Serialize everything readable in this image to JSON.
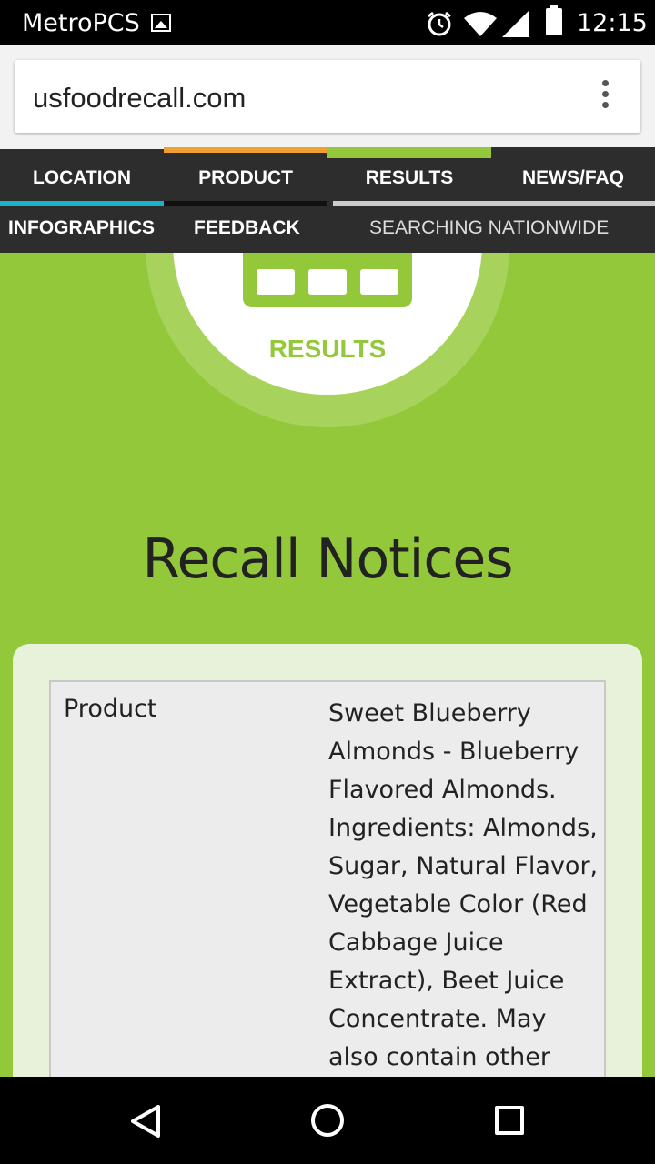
{
  "status_bar": {
    "carrier": "MetroPCS",
    "time": "12:15"
  },
  "browser": {
    "url": "usfoodrecall.com"
  },
  "nav": {
    "tabs": [
      {
        "label": "LOCATION",
        "top_color": "#2d2d2d",
        "bottom_color": "#1ab2c8"
      },
      {
        "label": "PRODUCT",
        "top_color": "#f0a030",
        "bottom_color": "#111111"
      },
      {
        "label": "RESULTS",
        "top_color": "#93c83b",
        "bottom_color": "#cccccc"
      },
      {
        "label": "NEWS/FAQ",
        "top_color": "#2d2d2d",
        "bottom_color": "#cccccc"
      }
    ],
    "row2": {
      "infographics": "INFOGRAPHICS",
      "feedback": "FEEDBACK",
      "searching": "SEARCHING NATIONWIDE"
    }
  },
  "results_badge": {
    "label": "RESULTS"
  },
  "heading": "Recall Notices",
  "recall": {
    "field": "Product",
    "value": "Sweet Blueberry Almonds - Blueberry Flavored Almonds. Ingredients: Almonds, Sugar, Natural Flavor, Vegetable Color (Red Cabbage Juice Extract), Beet Juice Concentrate. May also contain other tree"
  },
  "colors": {
    "brand_green": "#93c83b",
    "nav_dark": "#2d2d2d"
  }
}
